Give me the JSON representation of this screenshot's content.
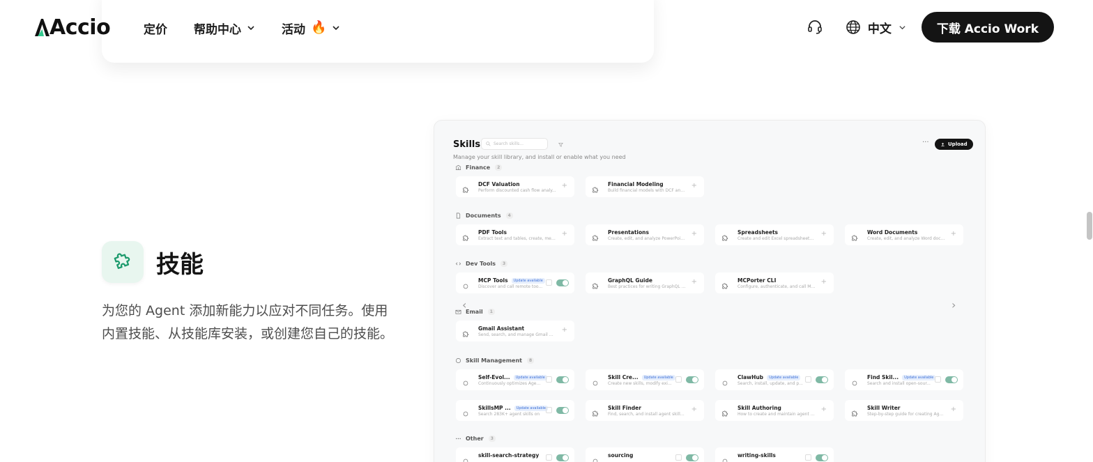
{
  "header": {
    "logo_text": "Accio",
    "nav": [
      {
        "label": "定价",
        "has_chevron": false
      },
      {
        "label": "帮助中心",
        "has_chevron": true
      },
      {
        "label": "活动",
        "has_chevron": true,
        "emoji": "🔥"
      }
    ],
    "language": "中文",
    "download_label": "下载 Accio Work"
  },
  "feature": {
    "title": "技能",
    "description": "为您的 Agent 添加新能力以应对不同任务。使用内置技能、从技能库安装，或创建您自己的技能。"
  },
  "skills_panel": {
    "title": "Skills",
    "search_placeholder": "Search skills...",
    "more": "···",
    "upload_label": "Upload",
    "subtitle": "Manage your skill library, and install or enable what you need",
    "sections": [
      {
        "name": "Finance",
        "count": "2",
        "icon": "bank-icon",
        "cards": [
          {
            "name": "DCF Valuation",
            "desc": "Perform discounted cash flow analy...",
            "action": "add"
          },
          {
            "name": "Financial Modeling",
            "desc": "Build financial models with DCF anal...",
            "action": "add"
          }
        ]
      },
      {
        "name": "Documents",
        "count": "4",
        "icon": "document-icon",
        "cards": [
          {
            "name": "PDF Tools",
            "desc": "Extract text and tables, create, merg...",
            "action": "add"
          },
          {
            "name": "Presentations",
            "desc": "Create, edit, and analyze PowerPoint...",
            "action": "add"
          },
          {
            "name": "Spreadsheets",
            "desc": "Create and edit Excel spreadsheets ...",
            "action": "add"
          },
          {
            "name": "Word Documents",
            "desc": "Create, edit, and analyze Word docu...",
            "action": "add"
          }
        ]
      },
      {
        "name": "Dev Tools",
        "count": "3",
        "icon": "code-icon",
        "cards": [
          {
            "name": "MCP Tools",
            "badge": "Update available",
            "desc": "Discover and call remote too...",
            "action": "toggle"
          },
          {
            "name": "GraphQL Guide",
            "desc": "Best practices for writing GraphQL q...",
            "action": "add"
          },
          {
            "name": "MCPorter CLI",
            "desc": "Configure, authenticate, and call MC...",
            "action": "add"
          }
        ]
      },
      {
        "name": "Email",
        "count": "1",
        "icon": "mail-icon",
        "cards": [
          {
            "name": "Gmail Assistant",
            "desc": "Send, search, and manage Gmail me...",
            "action": "add"
          }
        ]
      },
      {
        "name": "Skill Management",
        "count": "8",
        "icon": "puzzle-icon",
        "cards": [
          {
            "name": "Self-Evol...",
            "badge": "Update available",
            "desc": "Continuously optimizes Age...",
            "action": "toggle"
          },
          {
            "name": "Skill Cre...",
            "badge": "Update available",
            "desc": "Create new skills, modify exi...",
            "action": "toggle"
          },
          {
            "name": "ClawHub",
            "badge": "Update available",
            "desc": "Search, install, update, and p...",
            "action": "toggle"
          },
          {
            "name": "Find Skil...",
            "badge": "Update available",
            "desc": "Search and install open-sour...",
            "action": "toggle"
          },
          {
            "name": "SkillsMP ...",
            "badge": "Update available",
            "desc": "Search 283K+ agent skills on",
            "action": "toggle"
          },
          {
            "name": "Skill Finder",
            "desc": "Find, search, and install agent skills f...",
            "action": "add"
          },
          {
            "name": "Skill Authoring",
            "desc": "How to create and maintain agent s...",
            "action": "add"
          },
          {
            "name": "Skill Writer",
            "desc": "Step-by-step guide for creating Age...",
            "action": "add"
          }
        ]
      },
      {
        "name": "Other",
        "count": "3",
        "icon": "more-icon",
        "cards": [
          {
            "name": "skill-search-strategy",
            "desc": "",
            "action": "toggle"
          },
          {
            "name": "sourcing",
            "desc": "",
            "action": "toggle"
          },
          {
            "name": "writing-skills",
            "desc": "",
            "action": "toggle"
          }
        ]
      }
    ]
  }
}
